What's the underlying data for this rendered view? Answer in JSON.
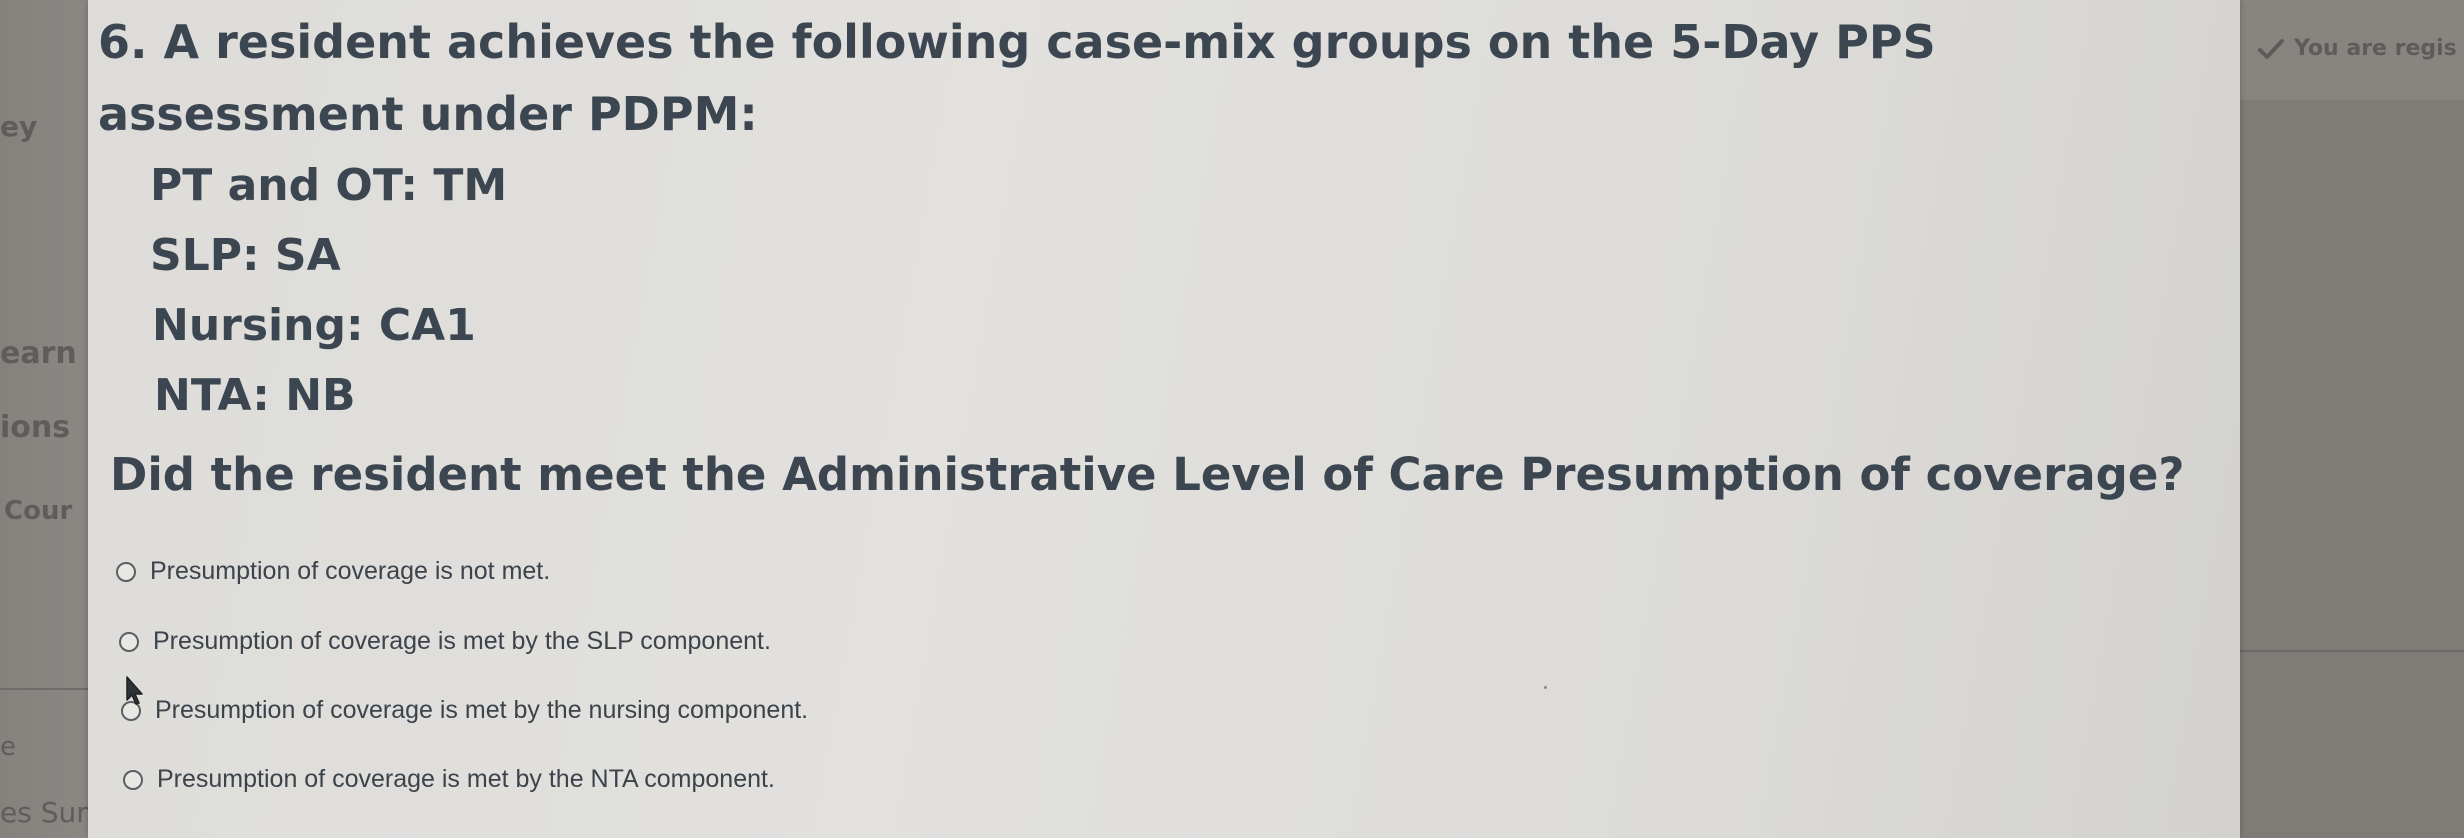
{
  "background": {
    "left_sidebar_fragments": [
      "ey",
      "earn",
      "ions",
      "Cour",
      "e",
      "es Sum"
    ],
    "registered_notice": "You are regis"
  },
  "question": {
    "title": "6. A resident achieves the following case-mix groups on the 5-Day PPS assessment under PDPM:",
    "case_mix_groups": [
      {
        "label": "PT and OT:",
        "value": "TM"
      },
      {
        "label": "SLP:",
        "value": "SA"
      },
      {
        "label": "Nursing:",
        "value": "CA1"
      },
      {
        "label": "NTA:",
        "value": "NB"
      }
    ],
    "prompt": "Did the resident meet the Administrative Level of Care Presumption of coverage?",
    "options": [
      "Presumption of coverage is not met.",
      "Presumption of coverage is met by the SLP component.",
      "Presumption of coverage is met by the nursing component.",
      "Presumption of coverage is met by the NTA component."
    ]
  },
  "icons": {
    "check": "check-icon",
    "radio": "radio-icon",
    "cursor": "mouse-pointer-icon"
  },
  "colors": {
    "card_background": "#e0dfdc",
    "text": "#3c4650",
    "page_background": "#8a8783"
  }
}
